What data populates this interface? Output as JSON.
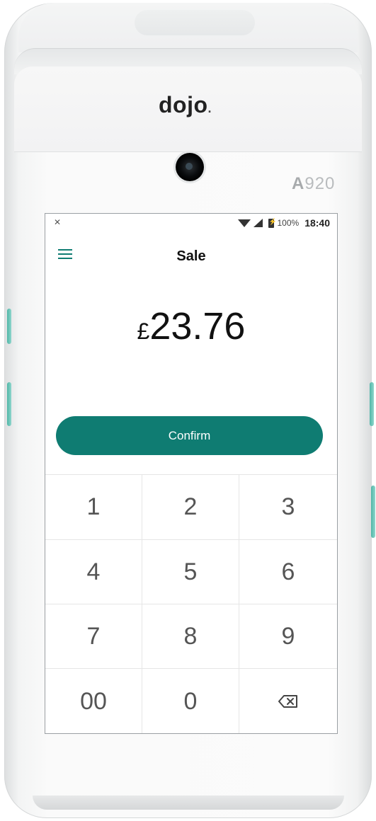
{
  "device": {
    "brand": "dojo",
    "brand_dot": ".",
    "model_prefix": "A",
    "model_number": "920"
  },
  "status_bar": {
    "left_icon": "notification-icon",
    "battery_percent": "100%",
    "time": "18:40"
  },
  "app_bar": {
    "title": "Sale",
    "menu_icon": "menu-icon"
  },
  "amount": {
    "currency": "£",
    "value": "23.76"
  },
  "confirm": {
    "label": "Confirm"
  },
  "keypad": {
    "keys": [
      "1",
      "2",
      "3",
      "4",
      "5",
      "6",
      "7",
      "8",
      "9",
      "00",
      "0"
    ],
    "backspace_icon": "backspace-icon"
  },
  "colors": {
    "accent": "#0f7c72"
  }
}
